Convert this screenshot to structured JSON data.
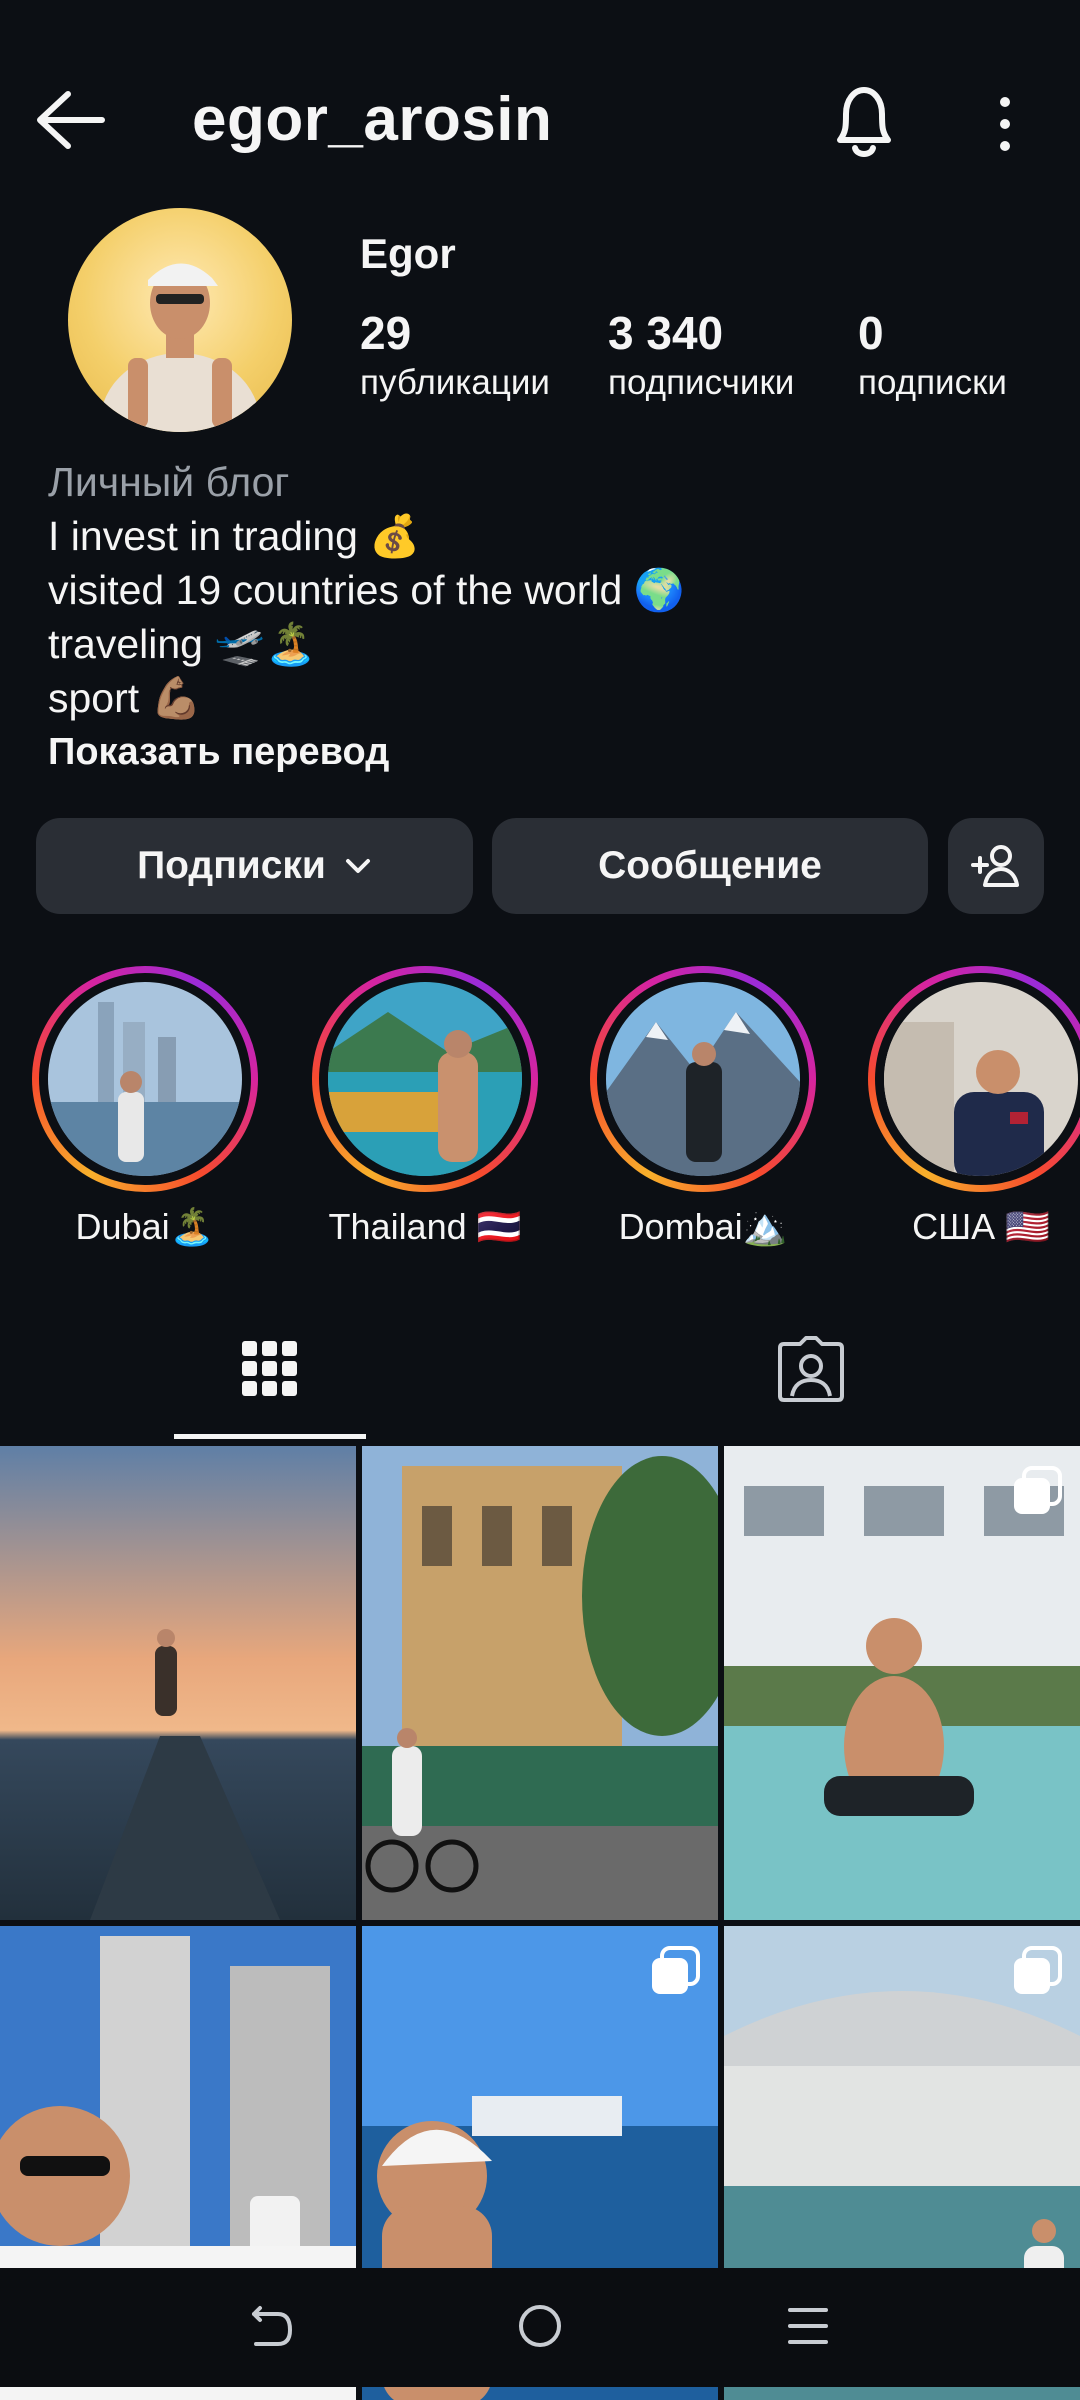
{
  "header": {
    "username": "egor_arosin",
    "back_icon": "arrow-left-icon",
    "bell_icon": "bell-icon",
    "more_icon": "more-vertical-icon"
  },
  "profile": {
    "display_name": "Egor",
    "stats": [
      {
        "value": "29",
        "label": "публикации"
      },
      {
        "value": "3 340",
        "label": "подписчики"
      },
      {
        "value": "0",
        "label": "подписки"
      }
    ],
    "category": "Личный блог",
    "bio_lines": [
      "I invest in trading 💰",
      "visited 19 countries of the world 🌍",
      "traveling 🛫🏝️",
      "sport 💪🏽"
    ],
    "show_translation": "Показать перевод"
  },
  "buttons": {
    "following": "Подписки",
    "message": "Сообщение",
    "add_user_icon": "add-user-icon"
  },
  "highlights": [
    {
      "label": "Dubai🏝️"
    },
    {
      "label": "Thailand 🇹🇭"
    },
    {
      "label": "Dombai🏔️"
    },
    {
      "label": "США 🇺🇸"
    }
  ],
  "tabs": {
    "grid_icon": "grid-icon",
    "tagged_icon": "tagged-person-icon"
  },
  "colors": {
    "background": "#0c0f14",
    "button": "#2a2e35",
    "muted_text": "#9aa0a8",
    "story_ring_start": "#f8b02b",
    "story_ring_end": "#d6249f"
  },
  "navbar": {
    "back_icon": "nav-back-icon",
    "home_icon": "nav-home-icon",
    "recents_icon": "nav-recents-icon"
  }
}
